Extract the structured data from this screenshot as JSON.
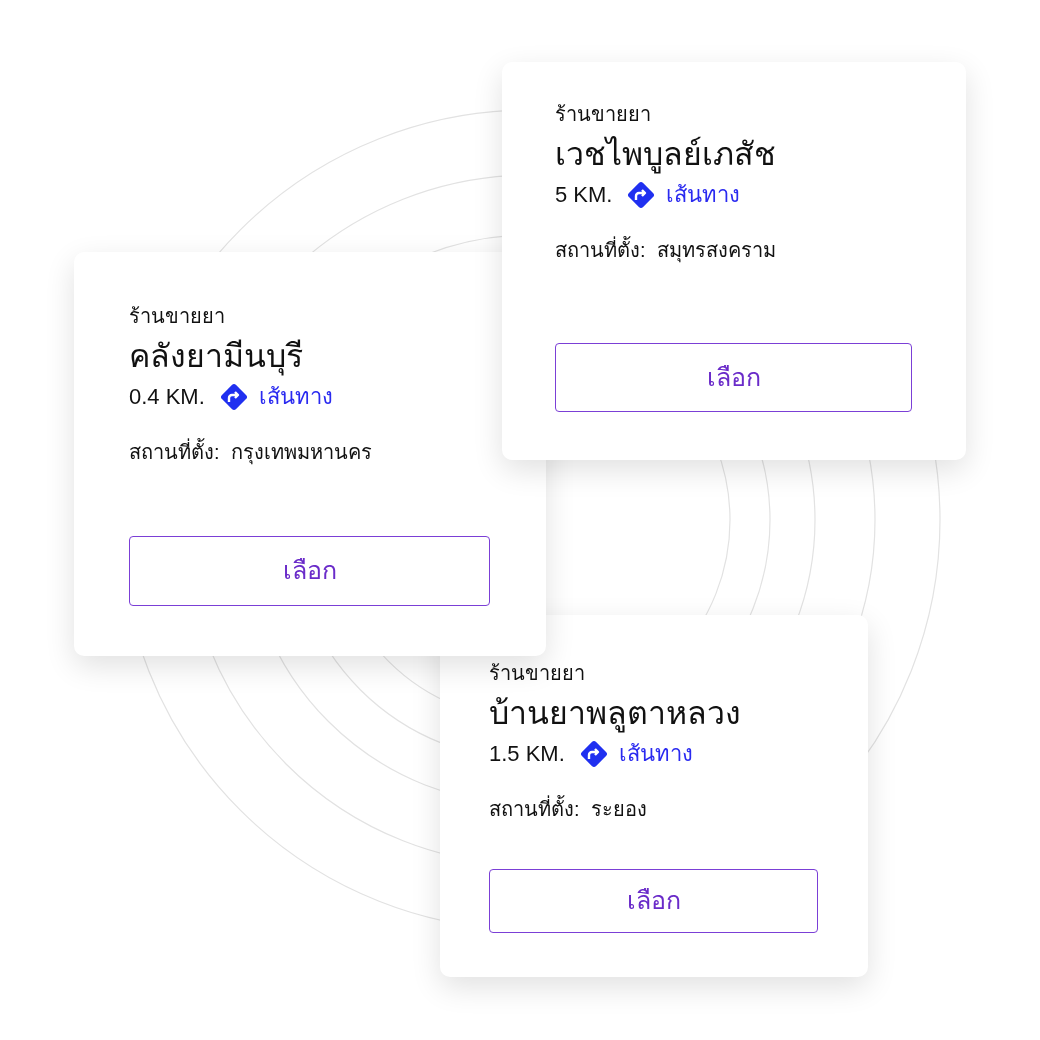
{
  "cards": [
    {
      "category": "ร้านขายยา",
      "name": "คลังยามีนบุรี",
      "distance": "0.4 KM.",
      "route_link": "เส้นทาง",
      "location_label": "สถานที่ตั้ง:",
      "location": "กรุงเทพมหานคร",
      "button": "เลือก"
    },
    {
      "category": "ร้านขายยา",
      "name": "เวชไพบูลย์เภสัช",
      "distance": "5 KM.",
      "route_link": "เส้นทาง",
      "location_label": "สถานที่ตั้ง:",
      "location": "สมุทรสงคราม",
      "button": "เลือก"
    },
    {
      "category": "ร้านขายยา",
      "name": "บ้านยาพลูตาหลวง",
      "distance": "1.5 KM.",
      "route_link": "เส้นทาง",
      "location_label": "สถานที่ตั้ง:",
      "location": "ระยอง",
      "button": "เลือก"
    }
  ]
}
